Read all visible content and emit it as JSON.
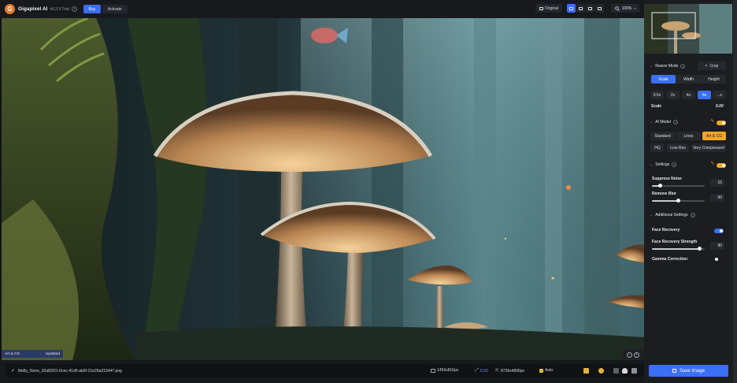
{
  "app": {
    "title": "Gigapixel AI",
    "version": "v6.3.3 Trial",
    "help": "?",
    "buy_label": "Buy",
    "activate_label": "Activate"
  },
  "toolbar": {
    "original_label": "Original",
    "zoom": "100%"
  },
  "canvas": {
    "model_tag": "Art & CG",
    "status": "Updated"
  },
  "file": {
    "check": "✓",
    "name": "fileBy_None_02a82f21-0cec-41d5-ab6f-21e26a315447.png",
    "input_size": "1456x816px",
    "scale": "6.00",
    "output_size": "8736x4896px",
    "auto_label": "Auto"
  },
  "resize": {
    "title": "Resize Mode",
    "crop_label": "Crop",
    "tabs": [
      "Scale",
      "Width",
      "Height"
    ],
    "active_tab": "Scale",
    "scales": [
      "0.5x",
      "2x",
      "4x",
      "6x",
      "...x"
    ],
    "active_scale": "6x",
    "scale_label": "Scale",
    "scale_value": "6.00"
  },
  "ai_model": {
    "title": "AI Model",
    "models_row1": [
      "Standard",
      "Lines",
      "Art & CG"
    ],
    "models_row2": [
      "HQ",
      "Low Res",
      "Very Compressed"
    ],
    "active_model": "Art & CG",
    "enabled": true
  },
  "settings": {
    "title": "Settings",
    "suppress_noise_label": "Suppress Noise",
    "suppress_noise_value": "15",
    "suppress_noise_fraction": 0.15,
    "remove_blur_label": "Remove Blur",
    "remove_blur_value": "50",
    "remove_blur_fraction": 0.5,
    "enabled": true
  },
  "additional": {
    "title": "Additional Settings",
    "face_recovery_label": "Face Recovery",
    "face_recovery_on": true,
    "face_strength_label": "Face Recovery Strength",
    "face_strength_value": "90",
    "face_strength_fraction": 0.9,
    "gamma_label": "Gamma Correction",
    "gamma_on": false
  },
  "save_label": "Save Image",
  "colors": {
    "accent_blue": "#3b6ff5",
    "accent_orange": "#f0a727",
    "panel": "#1b1d21"
  },
  "icons": [
    "gigapixel-logo-icon",
    "split-view-icon",
    "zoom-icon",
    "crop-icon",
    "lightning-icon",
    "save-icon",
    "user-icon",
    "trash-icon"
  ]
}
